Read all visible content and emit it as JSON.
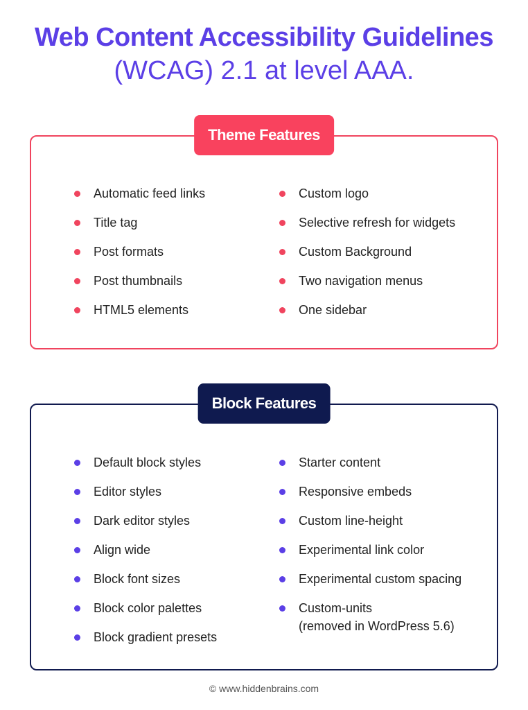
{
  "heading": {
    "line1": "Web Content Accessibility Guidelines",
    "line2": "(WCAG) 2.1 at level AAA."
  },
  "theme_features": {
    "badge": "Theme Features",
    "left": [
      "Automatic feed links",
      "Title tag",
      "Post formats",
      "Post thumbnails",
      "HTML5 elements"
    ],
    "right": [
      "Custom logo",
      "Selective refresh for widgets",
      "Custom Background",
      "Two navigation menus",
      "One sidebar"
    ]
  },
  "block_features": {
    "badge": "Block Features",
    "left": [
      "Default block styles",
      "Editor styles",
      "Dark editor styles",
      "Align wide",
      "Block font sizes",
      "Block color palettes",
      "Block gradient presets"
    ],
    "right": [
      "Starter content",
      "Responsive embeds",
      "Custom line-height",
      "Experimental link color",
      "Experimental custom spacing",
      "Custom-units"
    ],
    "right_note": "(removed in WordPress 5.6)"
  },
  "footer": "© www.hiddenbrains.com",
  "colors": {
    "title": "#5b3fe6",
    "theme_accent": "#f9425e",
    "block_accent": "#0f1a4f",
    "block_bullet": "#5b3fe6"
  },
  "icons": {
    "theme_bullet": "red-dot-icon",
    "block_bullet": "purple-dot-icon"
  }
}
